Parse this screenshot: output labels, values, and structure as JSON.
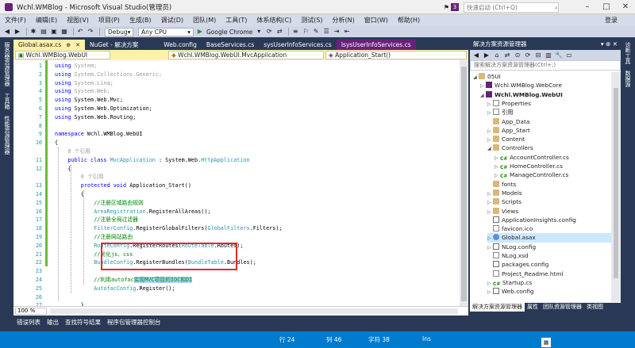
{
  "window": {
    "title": "Wchl.WMBlog - Microsoft Visual Studio(管理员)",
    "notification_count": "3",
    "quick_launch_placeholder": "快速启动 (Ctrl+Q)",
    "quick_launch_icon": "search-icon",
    "minimize": "–",
    "maximize": "□",
    "close": "✕"
  },
  "menu": {
    "items": [
      "文件(F)",
      "编辑(E)",
      "视图(V)",
      "项目(P)",
      "生成(B)",
      "调试(D)",
      "团队(M)",
      "工具(T)",
      "体系结构(C)",
      "测试(S)",
      "分析(N)",
      "窗口(W)",
      "帮助(H)"
    ],
    "login": "登录"
  },
  "toolbar": {
    "config": "Debug",
    "platform": "Any CPU",
    "browser": "Google Chrome",
    "dropdown_arrow": "▾"
  },
  "left_strip": {
    "tabs": [
      "服务器资源管理器",
      "工具箱",
      "性能资源管理器"
    ]
  },
  "right_strip": {
    "tabs": [
      "诊断工具",
      "数据源"
    ]
  },
  "doc_tabs": [
    {
      "label": "Global.asax.cs",
      "state": "active"
    },
    {
      "label": "NuGet - 解决方案",
      "state": "inactive"
    },
    {
      "label": "Web.config",
      "state": "inactive"
    },
    {
      "label": "BaseServices.cs",
      "state": "inactive"
    },
    {
      "label": "sysUserInfoServices.cs",
      "state": "inactive"
    },
    {
      "label": "IsysUserInfoServices.cs",
      "state": "preview"
    }
  ],
  "navbar": {
    "project": "Wchl.WMBlog.WebUI",
    "type": "Wchl.WMBlog.WebUI.MvcApplication",
    "member": "Application_Start()"
  },
  "editor": {
    "lines": [
      {
        "n": "1",
        "indent": 0,
        "parts": [
          [
            "kw",
            "using"
          ],
          [
            "",
            ""
          ],
          [
            "gr",
            " System;"
          ]
        ]
      },
      {
        "n": "2",
        "indent": 0,
        "parts": [
          [
            "kw",
            "using"
          ],
          [
            "gr",
            " System.Collections.Generic;"
          ]
        ]
      },
      {
        "n": "3",
        "indent": 0,
        "parts": [
          [
            "kw",
            "using"
          ],
          [
            "gr",
            " System.Linq;"
          ]
        ]
      },
      {
        "n": "4",
        "indent": 0,
        "parts": [
          [
            "kw",
            "using"
          ],
          [
            "gr",
            " System.Web;"
          ]
        ]
      },
      {
        "n": "5",
        "indent": 0,
        "parts": [
          [
            "kw",
            "using"
          ],
          [
            "",
            " System.Web.Mvc;"
          ]
        ]
      },
      {
        "n": "6",
        "indent": 0,
        "parts": [
          [
            "kw",
            "using"
          ],
          [
            "",
            " System.Web.Optimization;"
          ]
        ]
      },
      {
        "n": "7",
        "indent": 0,
        "parts": [
          [
            "kw",
            "using"
          ],
          [
            "",
            " System.Web.Routing;"
          ]
        ]
      },
      {
        "n": "8",
        "indent": 0,
        "parts": []
      },
      {
        "n": "9",
        "indent": 0,
        "parts": [
          [
            "kw",
            "namespace"
          ],
          [
            "",
            " Wchl.WMBlog.WebUI"
          ]
        ]
      },
      {
        "n": "10",
        "indent": 0,
        "parts": [
          [
            "",
            "{"
          ]
        ]
      },
      {
        "n": "",
        "indent": 4,
        "parts": [
          [
            "ref",
            "0 个引用"
          ]
        ]
      },
      {
        "n": "11",
        "indent": 4,
        "parts": [
          [
            "kw",
            "public class "
          ],
          [
            "ty",
            "MvcApplication"
          ],
          [
            "",
            " : System.Web."
          ],
          [
            "ty",
            "HttpApplication"
          ]
        ]
      },
      {
        "n": "12",
        "indent": 4,
        "parts": [
          [
            "",
            "{"
          ]
        ]
      },
      {
        "n": "",
        "indent": 8,
        "parts": [
          [
            "ref",
            "0 个引用"
          ]
        ]
      },
      {
        "n": "13",
        "indent": 8,
        "parts": [
          [
            "kw",
            "protected void "
          ],
          [
            "",
            "Application_Start()"
          ]
        ]
      },
      {
        "n": "14",
        "indent": 8,
        "parts": [
          [
            "",
            "{"
          ]
        ]
      },
      {
        "n": "15",
        "indent": 12,
        "parts": [
          [
            "cm",
            "//注册区域路由规则"
          ]
        ]
      },
      {
        "n": "16",
        "indent": 12,
        "parts": [
          [
            "ty",
            "AreaRegistration"
          ],
          [
            "",
            ".RegisterAllAreas();"
          ]
        ]
      },
      {
        "n": "17",
        "indent": 12,
        "parts": [
          [
            "cm",
            "//注册全局过滤器"
          ]
        ]
      },
      {
        "n": "18",
        "indent": 12,
        "parts": [
          [
            "ty",
            "FilterConfig"
          ],
          [
            "",
            ".RegisterGlobalFilters("
          ],
          [
            "ty",
            "GlobalFilters"
          ],
          [
            "",
            ".Filters);"
          ]
        ]
      },
      {
        "n": "19",
        "indent": 12,
        "parts": [
          [
            "cm",
            "//注册网站路由"
          ]
        ]
      },
      {
        "n": "20",
        "indent": 12,
        "parts": [
          [
            "ty",
            "RouteConfig"
          ],
          [
            "",
            ".RegisterRoutes("
          ],
          [
            "ty",
            "RouteTable"
          ],
          [
            "",
            ".Routes);"
          ]
        ]
      },
      {
        "n": "21",
        "indent": 12,
        "parts": [
          [
            "cm",
            "//优化js、css"
          ]
        ]
      },
      {
        "n": "22",
        "indent": 12,
        "parts": [
          [
            "ty",
            "BundleConfig"
          ],
          [
            "",
            ".RegisterBundles("
          ],
          [
            "ty",
            "BundleTable"
          ],
          [
            "",
            ".Bundles);"
          ]
        ]
      },
      {
        "n": "23",
        "indent": 0,
        "parts": []
      },
      {
        "n": "24",
        "indent": 12,
        "parts": [
          [
            "cm",
            "//利用autofac"
          ],
          [
            "cmhl",
            "实现MVC项目的IOC和DI"
          ]
        ]
      },
      {
        "n": "25",
        "indent": 12,
        "parts": [
          [
            "ty",
            "AutofacConfig"
          ],
          [
            "",
            ".Register();"
          ]
        ]
      },
      {
        "n": "26",
        "indent": 0,
        "parts": []
      },
      {
        "n": "27",
        "indent": 8,
        "parts": [
          [
            "",
            "}"
          ]
        ]
      },
      {
        "n": "28",
        "indent": 4,
        "parts": [
          [
            "",
            "}"
          ]
        ]
      },
      {
        "n": "29",
        "indent": 0,
        "parts": [
          [
            "",
            "}"
          ]
        ]
      },
      {
        "n": "30",
        "indent": 0,
        "parts": []
      }
    ],
    "zoom": "100 %"
  },
  "solution_explorer": {
    "title": "解决方案资源管理器",
    "search_placeholder": "搜索解决方案资源管理器(Ctrl+;)",
    "items": [
      {
        "label": "05UI",
        "depth": 0,
        "icon": "folder",
        "arrow": "◢"
      },
      {
        "label": "Wchl.WMBlog.WebCore",
        "depth": 1,
        "icon": "proj",
        "arrow": "▷"
      },
      {
        "label": "Wchl.WMBlog.WebUI",
        "depth": 1,
        "icon": "proj",
        "arrow": "◢",
        "bold": true
      },
      {
        "label": "Properties",
        "depth": 2,
        "icon": "file",
        "arrow": "▷"
      },
      {
        "label": "引用",
        "depth": 2,
        "icon": "file",
        "arrow": "▷"
      },
      {
        "label": "App_Data",
        "depth": 2,
        "icon": "folder",
        "arrow": ""
      },
      {
        "label": "App_Start",
        "depth": 2,
        "icon": "folder",
        "arrow": "▷"
      },
      {
        "label": "Content",
        "depth": 2,
        "icon": "folder",
        "arrow": "▷"
      },
      {
        "label": "Controllers",
        "depth": 2,
        "icon": "folder",
        "arrow": "◢"
      },
      {
        "label": "AccountController.cs",
        "depth": 3,
        "icon": "cs",
        "arrow": "▷"
      },
      {
        "label": "HomeController.cs",
        "depth": 3,
        "icon": "cs",
        "arrow": "▷"
      },
      {
        "label": "ManageController.cs",
        "depth": 3,
        "icon": "cs",
        "arrow": "▷"
      },
      {
        "label": "fonts",
        "depth": 2,
        "icon": "folder",
        "arrow": ""
      },
      {
        "label": "Models",
        "depth": 2,
        "icon": "folder",
        "arrow": "▷"
      },
      {
        "label": "Scripts",
        "depth": 2,
        "icon": "folder",
        "arrow": "▷"
      },
      {
        "label": "Views",
        "depth": 2,
        "icon": "folder",
        "arrow": "▷"
      },
      {
        "label": "ApplicationInsights.config",
        "depth": 2,
        "icon": "cfg",
        "arrow": ""
      },
      {
        "label": "favicon.ico",
        "depth": 2,
        "icon": "file",
        "arrow": ""
      },
      {
        "label": "Global.asax",
        "depth": 2,
        "icon": "web",
        "arrow": "▷",
        "selected": true
      },
      {
        "label": "NLog.config",
        "depth": 2,
        "icon": "cfg",
        "arrow": "▷"
      },
      {
        "label": "NLog.xsd",
        "depth": 2,
        "icon": "file",
        "arrow": ""
      },
      {
        "label": "packages.config",
        "depth": 2,
        "icon": "cfg",
        "arrow": ""
      },
      {
        "label": "Project_Readme.html",
        "depth": 2,
        "icon": "file",
        "arrow": ""
      },
      {
        "label": "Startup.cs",
        "depth": 2,
        "icon": "cs",
        "arrow": "▷"
      },
      {
        "label": "Web.config",
        "depth": 2,
        "icon": "cfg",
        "arrow": "▷"
      }
    ],
    "bottom_tabs": [
      {
        "label": "解决方案资源管理器",
        "active": true
      },
      {
        "label": "属性",
        "active": false
      },
      {
        "label": "团队资源管理器",
        "active": false
      },
      {
        "label": "类视图",
        "active": false
      }
    ]
  },
  "output_tabs": [
    "错误列表",
    "输出",
    "查找符号结果",
    "程序包管理器控制台"
  ],
  "status": {
    "row": "行 24",
    "col": "列 46",
    "ch": "字符 38",
    "mode": "Ins",
    "ime_icons": [
      "S",
      "中",
      "•",
      "☺",
      "⌨",
      "♟",
      "⚙",
      "▦"
    ]
  },
  "colors": {
    "frame": "#293955",
    "active_tab": "#fff1a8",
    "status_bar": "#007acc",
    "highlight_box": "#e02b2b"
  }
}
